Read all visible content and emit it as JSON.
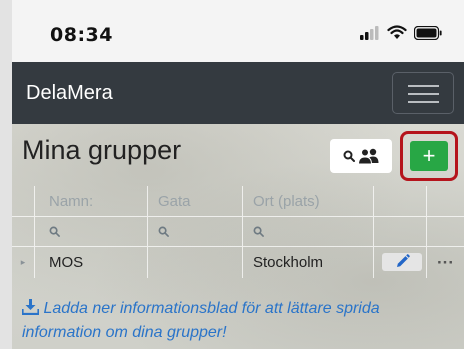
{
  "status_bar": {
    "time": "08:34"
  },
  "navbar": {
    "brand": "DelaMera"
  },
  "page": {
    "title": "Mina grupper"
  },
  "toolbar": {
    "add_label": "+"
  },
  "table": {
    "headers": [
      "Namn:",
      "Gata",
      "Ort (plats)"
    ],
    "rows": [
      {
        "expander": "▸",
        "name": "MOS",
        "street": "",
        "city": "Stockholm",
        "more": "···"
      }
    ]
  },
  "download": {
    "text": "Ladda ner informationsblad för att lättare sprida information om dina grupper!"
  },
  "colors": {
    "navbar": "#343a40",
    "add_button": "#28a745",
    "highlight": "#b5141c",
    "link": "#2a74c9"
  }
}
